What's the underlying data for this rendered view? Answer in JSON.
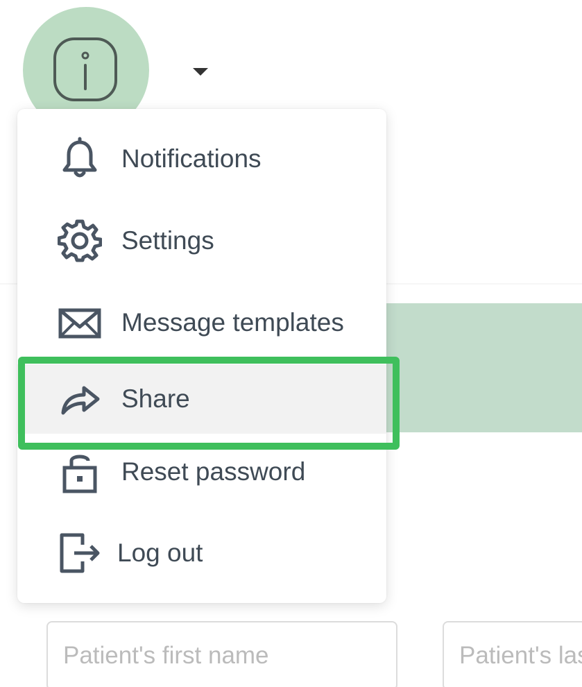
{
  "avatar": {
    "icon": "info-icon",
    "bg_color": "#bcdcc3"
  },
  "menu": {
    "items": [
      {
        "label": "Notifications",
        "icon": "bell-icon"
      },
      {
        "label": "Settings",
        "icon": "gear-icon"
      },
      {
        "label": "Message templates",
        "icon": "envelope-icon"
      },
      {
        "label": "Share",
        "icon": "share-arrow-icon",
        "active": true
      },
      {
        "label": "Reset password",
        "icon": "padlock-icon"
      },
      {
        "label": "Log out",
        "icon": "logout-icon"
      }
    ]
  },
  "form": {
    "first_name_placeholder": "Patient's first name",
    "last_name_placeholder": "Patient's last name"
  },
  "colors": {
    "highlight": "#3fbf5c",
    "banner": "#c2dccb",
    "icon": "#4a5563"
  }
}
